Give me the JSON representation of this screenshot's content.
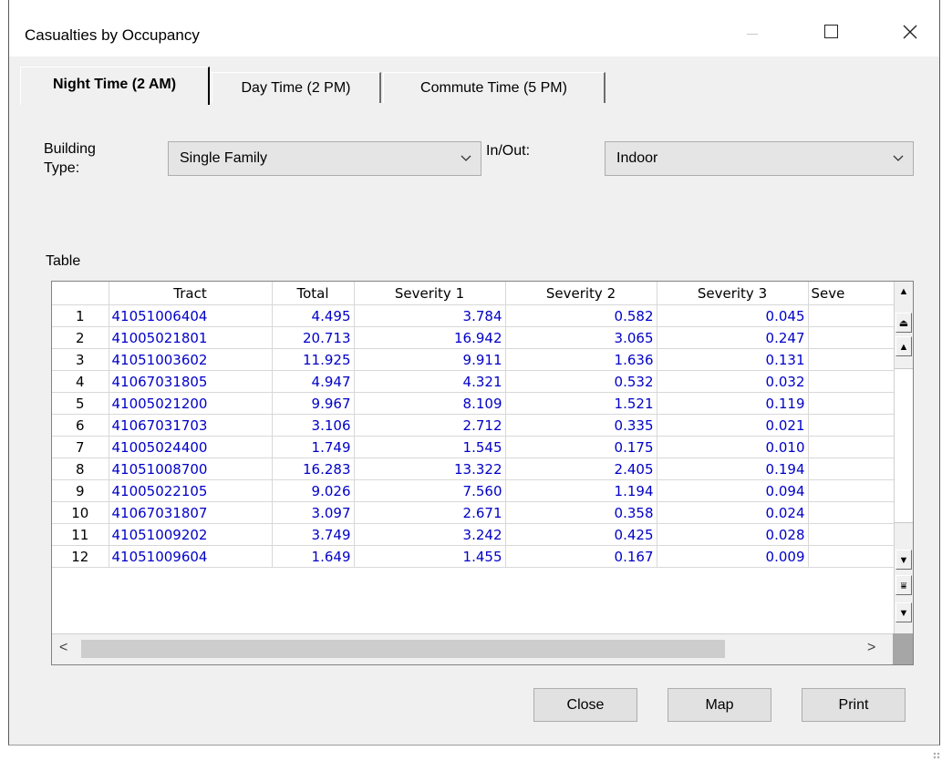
{
  "window": {
    "title": "Casualties by Occupancy"
  },
  "tabs": [
    {
      "label": "Night Time (2 AM)",
      "active": true
    },
    {
      "label": "Day Time (2 PM)",
      "active": false
    },
    {
      "label": "Commute Time (5 PM)",
      "active": false
    }
  ],
  "filters": {
    "building_type_label": "Building Type:",
    "building_type_label_l1": "Building",
    "building_type_label_l2": "Type:",
    "building_type_value": "Single Family",
    "inout_label": "In/Out:",
    "inout_value": "Indoor"
  },
  "table": {
    "label": "Table",
    "columns": [
      "",
      "Tract",
      "Total",
      "Severity 1",
      "Severity 2",
      "Severity 3",
      "Seve"
    ],
    "rows": [
      [
        "1",
        "41051006404",
        "4.495",
        "3.784",
        "0.582",
        "0.045"
      ],
      [
        "2",
        "41005021801",
        "20.713",
        "16.942",
        "3.065",
        "0.247"
      ],
      [
        "3",
        "41051003602",
        "11.925",
        "9.911",
        "1.636",
        "0.131"
      ],
      [
        "4",
        "41067031805",
        "4.947",
        "4.321",
        "0.532",
        "0.032"
      ],
      [
        "5",
        "41005021200",
        "9.967",
        "8.109",
        "1.521",
        "0.119"
      ],
      [
        "6",
        "41067031703",
        "3.106",
        "2.712",
        "0.335",
        "0.021"
      ],
      [
        "7",
        "41005024400",
        "1.749",
        "1.545",
        "0.175",
        "0.010"
      ],
      [
        "8",
        "41051008700",
        "16.283",
        "13.322",
        "2.405",
        "0.194"
      ],
      [
        "9",
        "41005022105",
        "9.026",
        "7.560",
        "1.194",
        "0.094"
      ],
      [
        "10",
        "41067031807",
        "3.097",
        "2.671",
        "0.358",
        "0.024"
      ],
      [
        "11",
        "41051009202",
        "3.749",
        "3.242",
        "0.425",
        "0.028"
      ],
      [
        "12",
        "41051009604",
        "1.649",
        "1.455",
        "0.167",
        "0.009"
      ]
    ]
  },
  "buttons": {
    "close": "Close",
    "map": "Map",
    "print": "Print"
  },
  "colors": {
    "link_text": "#0000c8",
    "window_bg": "#f0f0f0"
  }
}
